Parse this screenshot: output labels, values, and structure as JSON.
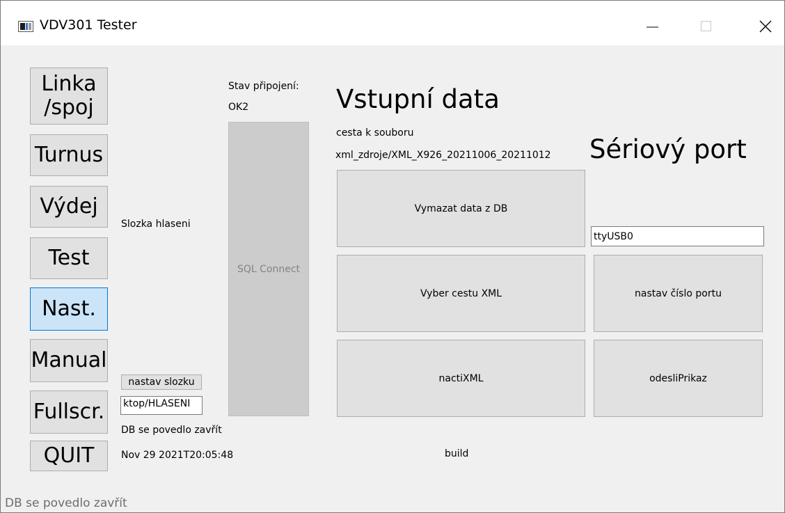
{
  "window": {
    "title": "VDV301 Tester"
  },
  "nav": {
    "linka": "Linka\n/spoj",
    "turnus": "Turnus",
    "vydej": "Výdej",
    "test": "Test",
    "nast": "Nast.",
    "manual": "Manual",
    "fullscr": "Fullscr.",
    "quit": "QUIT"
  },
  "hlaseni": {
    "folder_label": "Slozka hlaseni",
    "set_folder_button": "nastav slozku",
    "folder_path_value": "ktop/HLASENI"
  },
  "connection": {
    "status_label": "Stav připojení:",
    "status_value": "OK2",
    "sql_connect_button": "SQL Connect"
  },
  "messages": {
    "db_closed": "DB se povedlo zavřít",
    "build_date": "Nov 29 2021T20:05:48",
    "build_label": "build"
  },
  "input_data": {
    "heading": "Vstupní data",
    "path_label": "cesta k souboru",
    "path_value": "xml_zdroje/XML_X926_20211006_20211012",
    "clear_db_button": "Vymazat data z DB",
    "choose_xml_button": "Vyber cestu XML",
    "load_xml_button": "nactiXML"
  },
  "serial": {
    "heading": "Sériový port",
    "port_value": "ttyUSB0",
    "set_port_button": "nastav číslo portu",
    "send_command_button": "odesliPrikaz"
  },
  "status_bar": {
    "text": "DB se povedlo zavřít"
  }
}
